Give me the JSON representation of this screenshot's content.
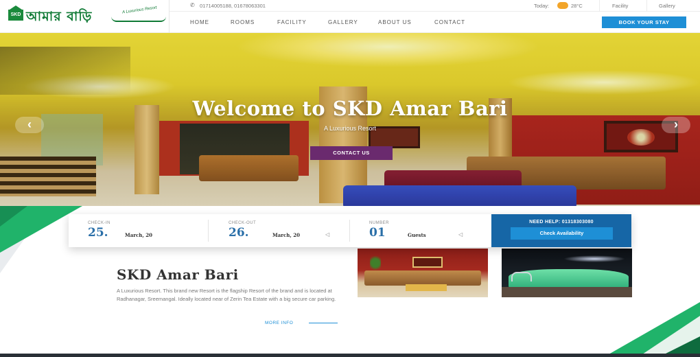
{
  "brand": {
    "logo_text": "আমার বাড়ি",
    "logo_mark": "SKD",
    "tagline": "A Luxurious Resort"
  },
  "topbar": {
    "phones": "01714005188, 01678063301",
    "today_label": "Today:",
    "temperature": "28°C",
    "links": [
      "Facility",
      "Gallery"
    ]
  },
  "nav": {
    "items": [
      "HOME",
      "ROOMS",
      "FACILITY",
      "GALLERY",
      "ABOUT US",
      "CONTACT"
    ],
    "book_label": "BOOK YOUR STAY"
  },
  "hero": {
    "title": "Welcome to SKD Amar Bari",
    "subtitle": "A Luxurious Resort",
    "cta_label": "CONTACT US",
    "prev_arrow": "‹",
    "next_arrow": "›"
  },
  "booking": {
    "check_in": {
      "label": "CHECK-IN",
      "day": "25.",
      "month": "March, 20"
    },
    "check_out": {
      "label": "CHECK-OUT",
      "day": "26.",
      "month": "March, 20"
    },
    "number": {
      "label": "NUMBER",
      "value": "01",
      "unit": "Guests"
    },
    "help_text": "NEED HELP: 01318303080",
    "check_label": "Check Availability"
  },
  "about": {
    "title": "SKD Amar Bari",
    "description": "A Luxurious Resort. This brand new Resort is the flagship Resort of the brand and is located at Radhanagar, Sreemangal. Ideally located near of Zerin Tea Estate with a big secure car parking.",
    "more_label": "MORE INFO"
  },
  "colors": {
    "accent_blue": "#1e8fd6",
    "dark_blue": "#1666a6",
    "cta_purple": "#6a2a6e",
    "brand_green": "#0f7a35"
  },
  "icons": {
    "phone": "phone-icon",
    "weather": "weather-icon",
    "prev": "chevron-left-icon",
    "next": "chevron-right-icon"
  }
}
